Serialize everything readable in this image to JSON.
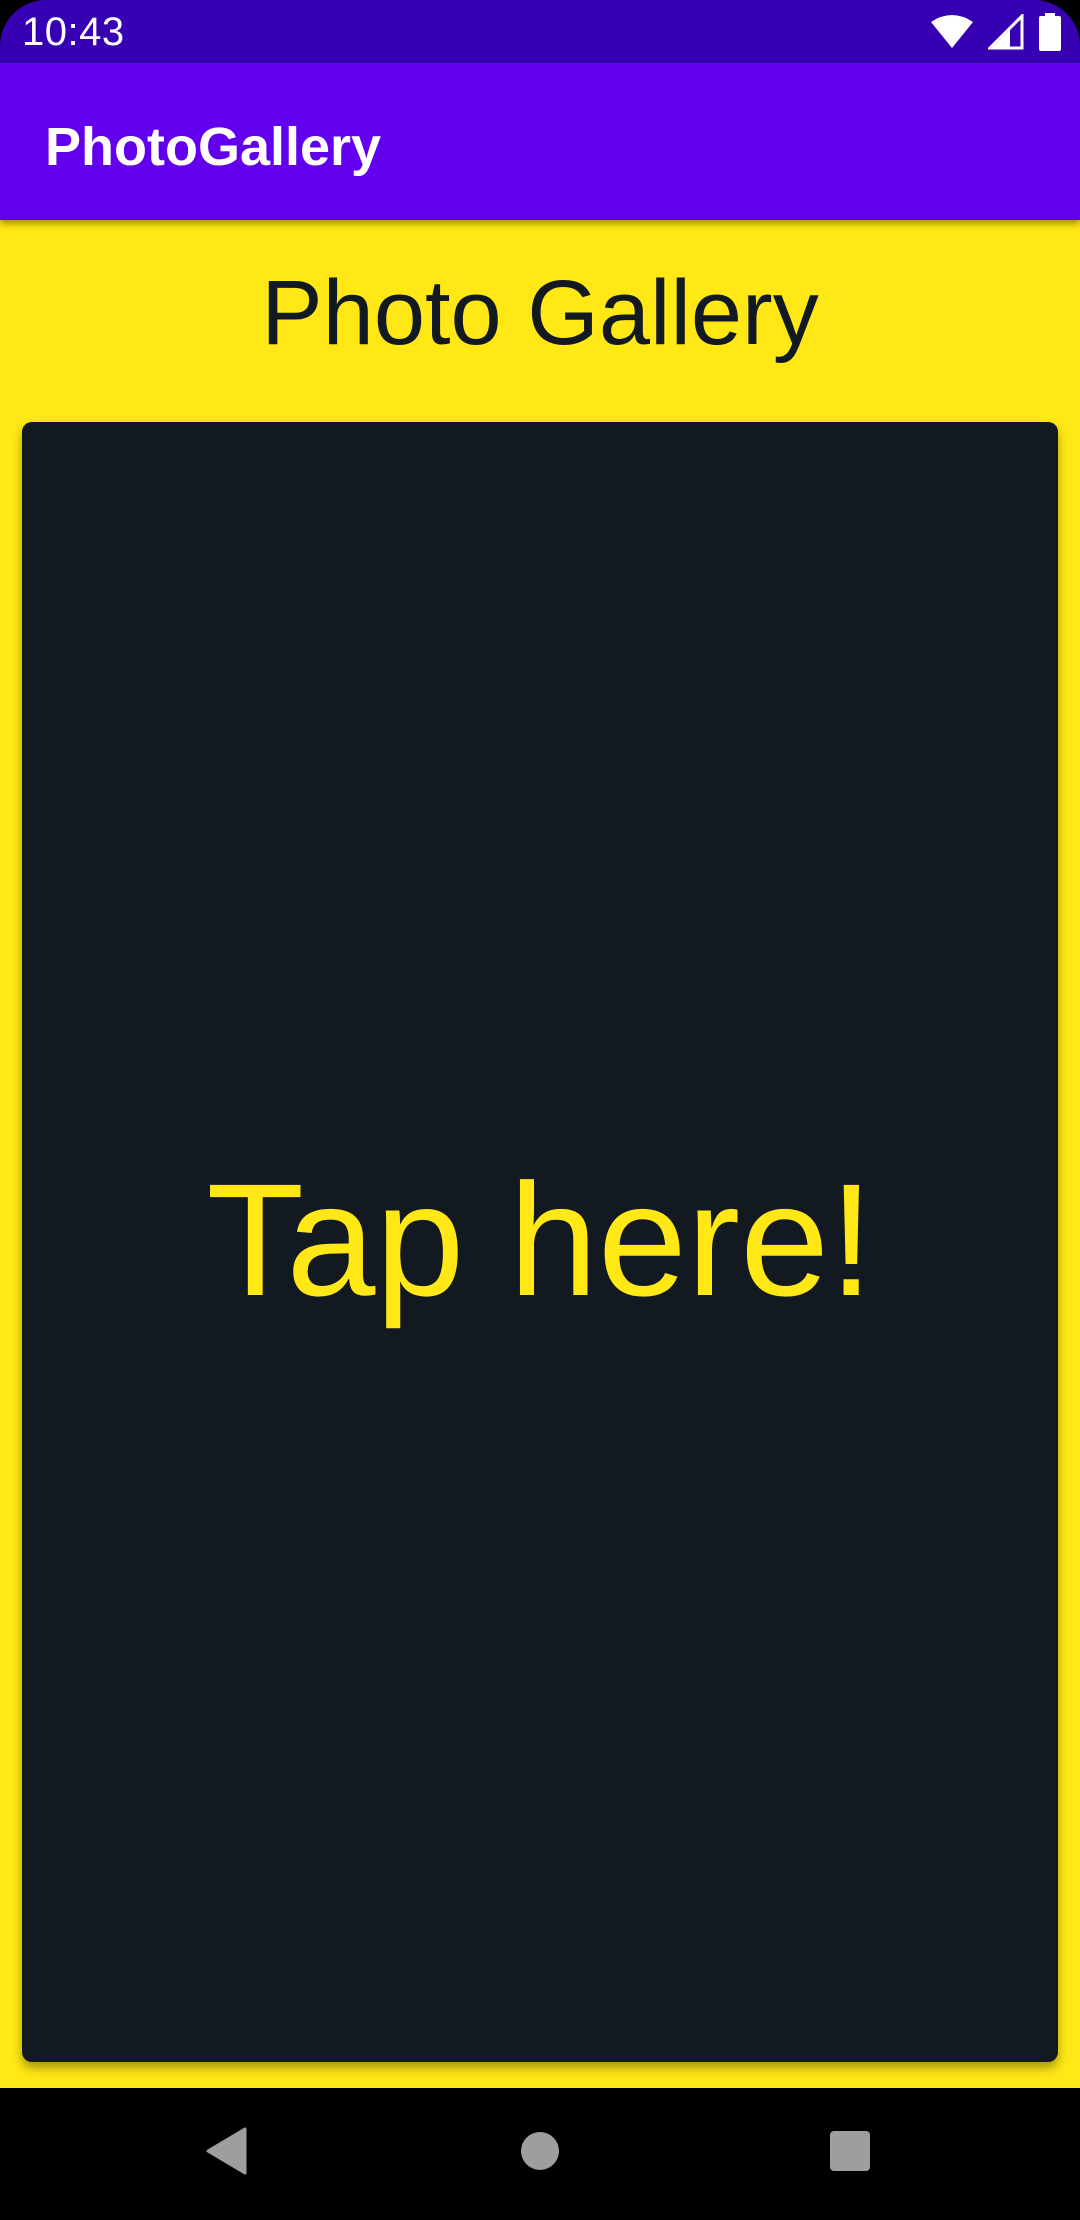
{
  "status_bar": {
    "time": "10:43",
    "background": "#3700B3",
    "icons": [
      "wifi-icon",
      "cellular-signal-icon",
      "battery-icon"
    ]
  },
  "app_bar": {
    "title": "PhotoGallery",
    "background": "#6200EE"
  },
  "main": {
    "heading": "Photo Gallery",
    "tap_card": {
      "label": "Tap here!"
    },
    "colors": {
      "background": "#FFE815",
      "card": "#121920",
      "heading_text": "#121920",
      "card_text": "#FFE815"
    }
  },
  "nav_bar": {
    "buttons": [
      "back-icon",
      "home-icon",
      "recents-icon"
    ],
    "icon_color": "#9E9E9E"
  }
}
